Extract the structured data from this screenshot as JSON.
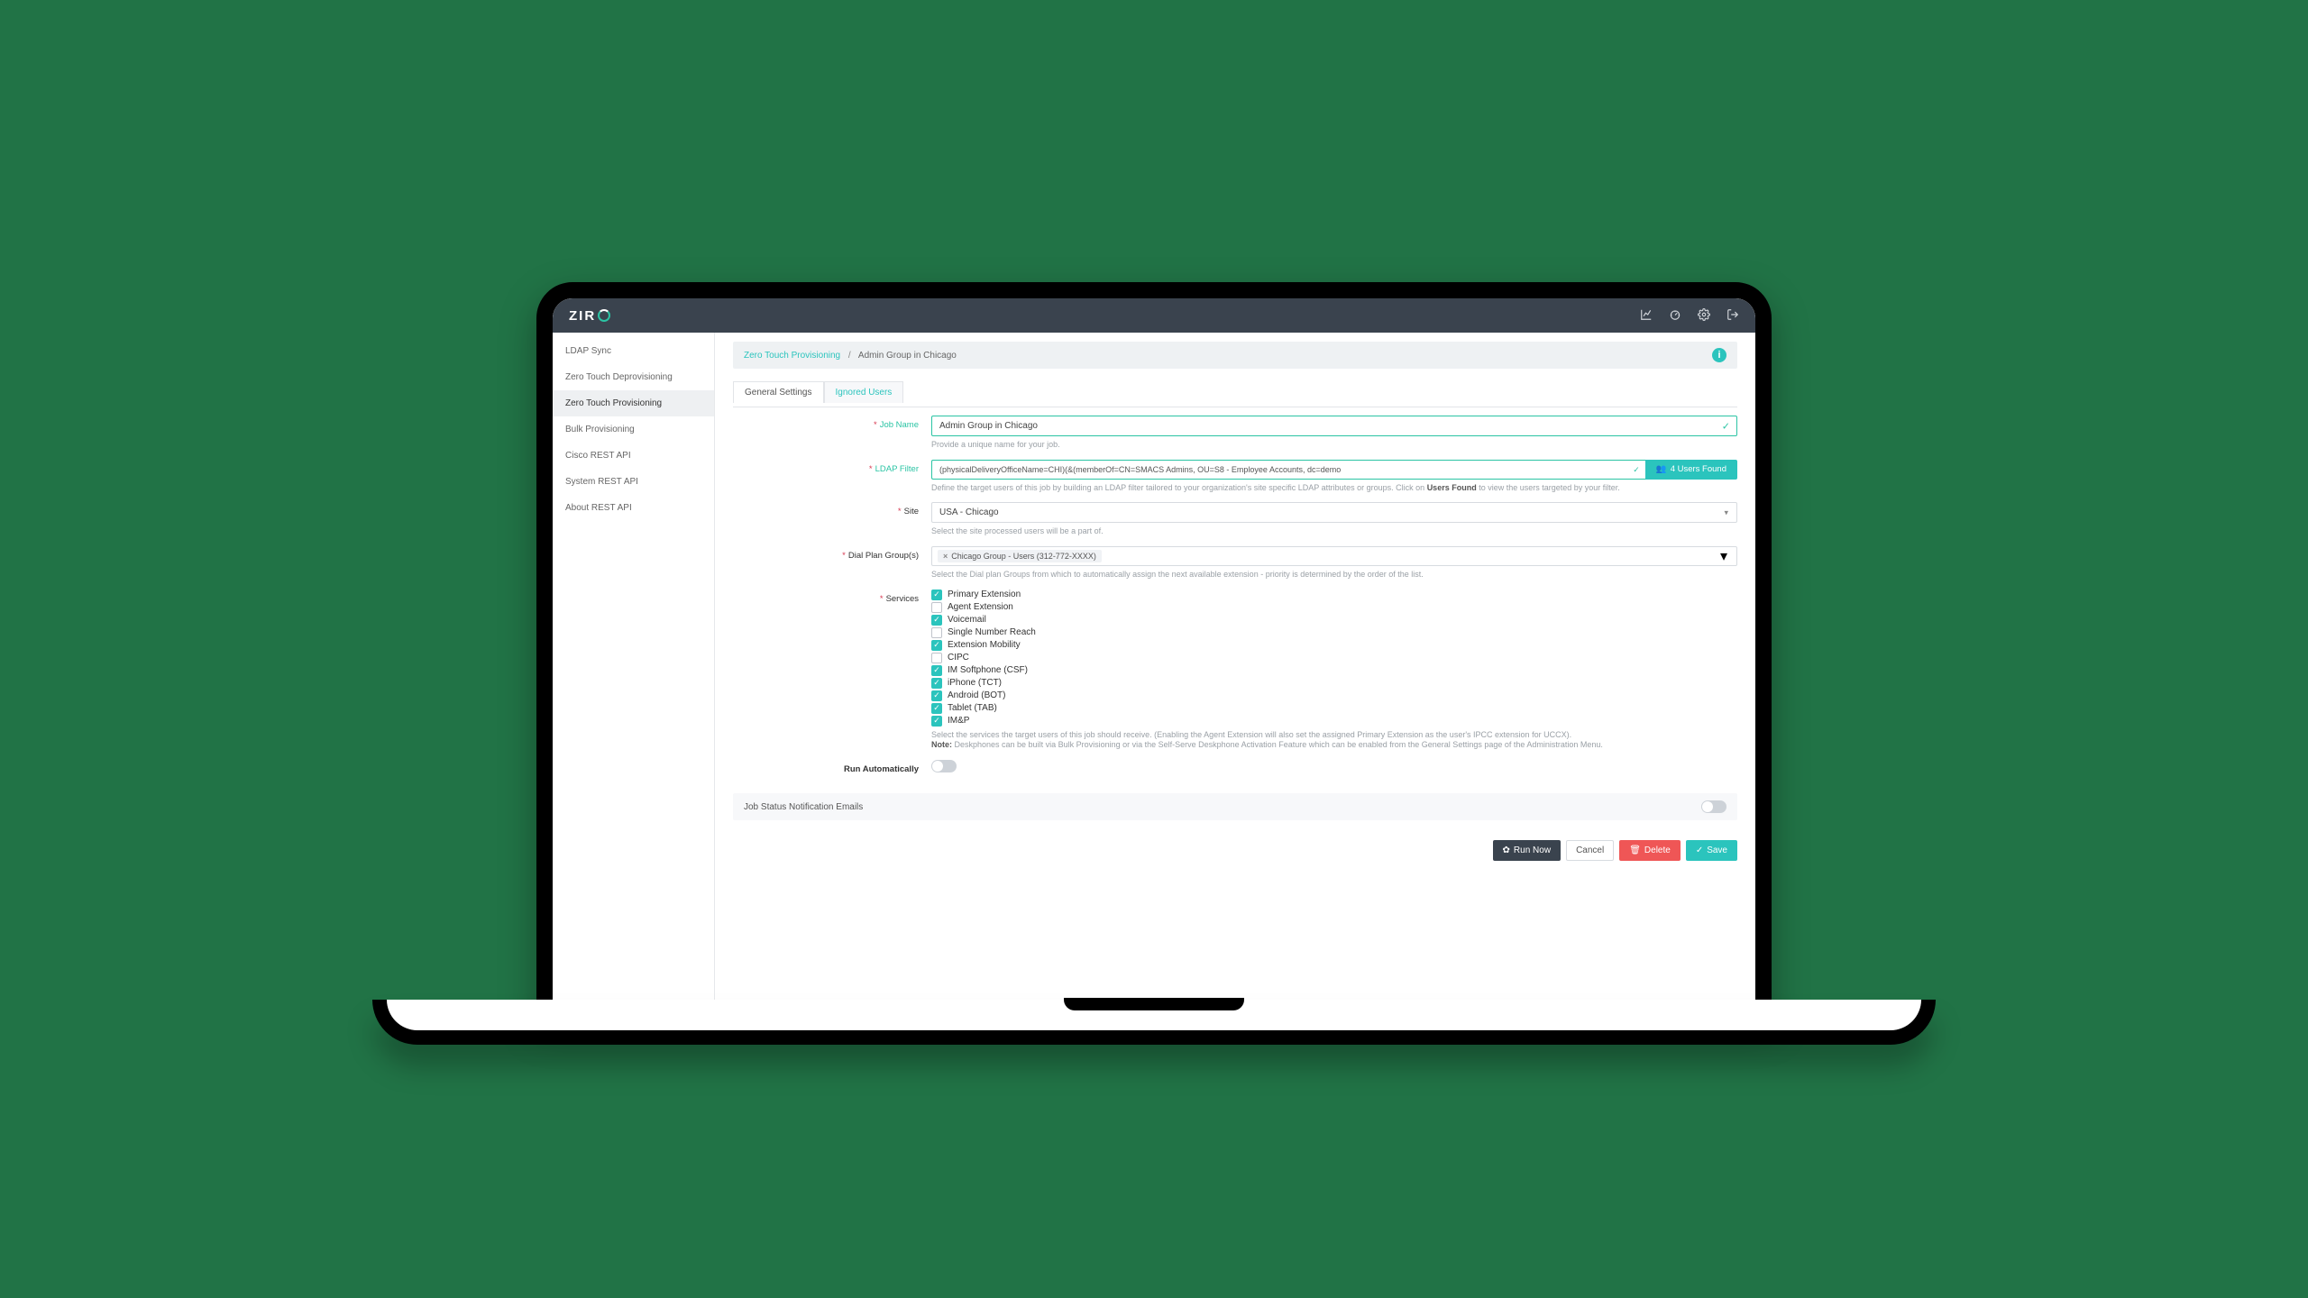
{
  "logo": "ZIR",
  "sidebar": {
    "items": [
      {
        "label": "LDAP Sync"
      },
      {
        "label": "Zero Touch Deprovisioning"
      },
      {
        "label": "Zero Touch Provisioning"
      },
      {
        "label": "Bulk Provisioning"
      },
      {
        "label": "Cisco REST API"
      },
      {
        "label": "System REST API"
      },
      {
        "label": "About REST API"
      }
    ],
    "active_index": 2
  },
  "breadcrumb": {
    "link": "Zero Touch Provisioning",
    "current": "Admin Group in Chicago"
  },
  "tabs": [
    {
      "label": "General Settings"
    },
    {
      "label": "Ignored Users"
    }
  ],
  "active_tab": 0,
  "form": {
    "job_name_label": "Job Name",
    "job_name_value": "Admin Group in Chicago",
    "job_name_helper": "Provide a unique name for your job.",
    "ldap_label": "LDAP Filter",
    "ldap_value": "(physicalDeliveryOfficeName=CHI)(&(memberOf=CN=SMACS Admins, OU=S8 - Employee Accounts, dc=demo",
    "users_found": "4 Users Found",
    "ldap_helper_pre": "Define the target users of this job by building an LDAP filter tailored to your organization's site specific LDAP attributes or groups. Click on ",
    "ldap_helper_link": "Users Found",
    "ldap_helper_post": " to view the users targeted by your filter.",
    "site_label": "Site",
    "site_value": "USA - Chicago",
    "site_helper": "Select the site processed users will be a part of.",
    "dpg_label": "Dial Plan Group(s)",
    "dpg_tag": "Chicago Group - Users (312-772-XXXX)",
    "dpg_helper": "Select the Dial plan Groups from which to automatically assign the next available extension - priority is determined by the order of the list.",
    "services_label": "Services",
    "services": [
      {
        "label": "Primary Extension",
        "checked": true
      },
      {
        "label": "Agent Extension",
        "checked": false
      },
      {
        "label": "Voicemail",
        "checked": true
      },
      {
        "label": "Single Number Reach",
        "checked": false
      },
      {
        "label": "Extension Mobility",
        "checked": true
      },
      {
        "label": "CIPC",
        "checked": false
      },
      {
        "label": "IM Softphone (CSF)",
        "checked": true
      },
      {
        "label": "iPhone (TCT)",
        "checked": true
      },
      {
        "label": "Android (BOT)",
        "checked": true
      },
      {
        "label": "Tablet (TAB)",
        "checked": true
      },
      {
        "label": "IM&P",
        "checked": true
      }
    ],
    "services_helper_1": "Select the services the target users of this job should receive. (Enabling the Agent Extension will also set the assigned Primary Extension as the user's IPCC extension for UCCX).",
    "services_helper_note": "Note:",
    "services_helper_2": " Deskphones can be built via Bulk Provisioning or via the Self-Serve Deskphone Activation Feature which can be enabled from the General Settings page of the Administration Menu.",
    "run_auto_label": "Run Automatically"
  },
  "collapsible": {
    "title": "Job Status Notification Emails"
  },
  "actions": {
    "run_now": "Run Now",
    "cancel": "Cancel",
    "delete": "Delete",
    "save": "Save"
  }
}
